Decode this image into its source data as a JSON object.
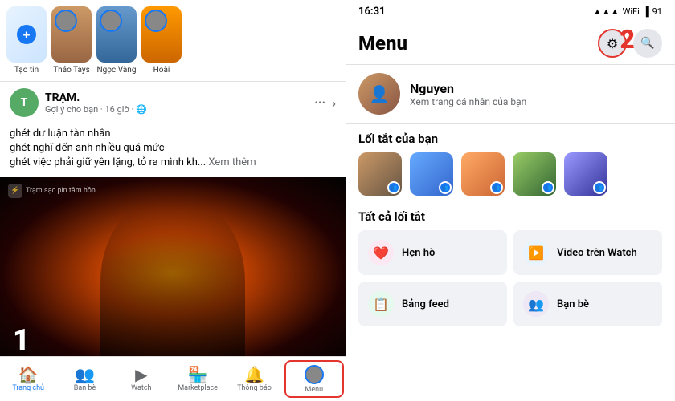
{
  "left": {
    "stories": [
      {
        "label": "Tạo tin",
        "type": "create"
      },
      {
        "label": "Thảo Tâys",
        "type": "person",
        "bg": "story-bg-1"
      },
      {
        "label": "Ngọc Vàng",
        "type": "person",
        "bg": "story-bg-2"
      },
      {
        "label": "Hoài",
        "type": "person",
        "bg": "story-bg-3"
      }
    ],
    "post": {
      "author": "TRẠM.",
      "subtitle": "Gợi ý cho bạn · 16 giờ · 🌐",
      "lines": [
        "ghét dư luận tàn nhẫn",
        "ghét nghĩ đến anh nhiều quá mức",
        "ghét việc phải giữ yên lặng, tỏ ra mình kh..."
      ],
      "see_more": "Xem thêm",
      "watermark": "Trạm sạc pin\ntâm hồn.",
      "number": "1"
    },
    "nav": [
      {
        "label": "Trang chủ",
        "icon": "🏠",
        "active": true
      },
      {
        "label": "Bạn bè",
        "icon": "👥",
        "active": false
      },
      {
        "label": "Watch",
        "icon": "▶",
        "active": false
      },
      {
        "label": "Marketplace",
        "icon": "🏪",
        "active": false
      },
      {
        "label": "Thông báo",
        "icon": "🔔",
        "active": false
      },
      {
        "label": "Menu",
        "icon": "≡",
        "active": false,
        "avatar": true
      }
    ]
  },
  "right": {
    "status_bar": {
      "time": "16:31",
      "battery": "91"
    },
    "menu": {
      "title": "Menu",
      "gear_label": "⚙",
      "search_label": "🔍",
      "number": "2"
    },
    "profile": {
      "name": "Nguyen",
      "subtitle": "Xem trang cá nhân của bạn"
    },
    "shortcuts_title": "Lối tắt của bạn",
    "shortcuts": [
      {
        "bg": "sg1"
      },
      {
        "bg": "sg2"
      },
      {
        "bg": "sg3"
      },
      {
        "bg": "sg4"
      },
      {
        "bg": "sg5"
      }
    ],
    "all_shortcuts_title": "Tất cả lối tắt",
    "cards": [
      {
        "label": "Hẹn hò",
        "icon": "❤️",
        "color": "pink"
      },
      {
        "label": "Video trên Watch",
        "icon": "▶️",
        "color": "blue"
      },
      {
        "label": "Bảng feed",
        "icon": "📋",
        "color": "green"
      },
      {
        "label": "Bạn bè",
        "icon": "👥",
        "color": "purple"
      }
    ]
  }
}
